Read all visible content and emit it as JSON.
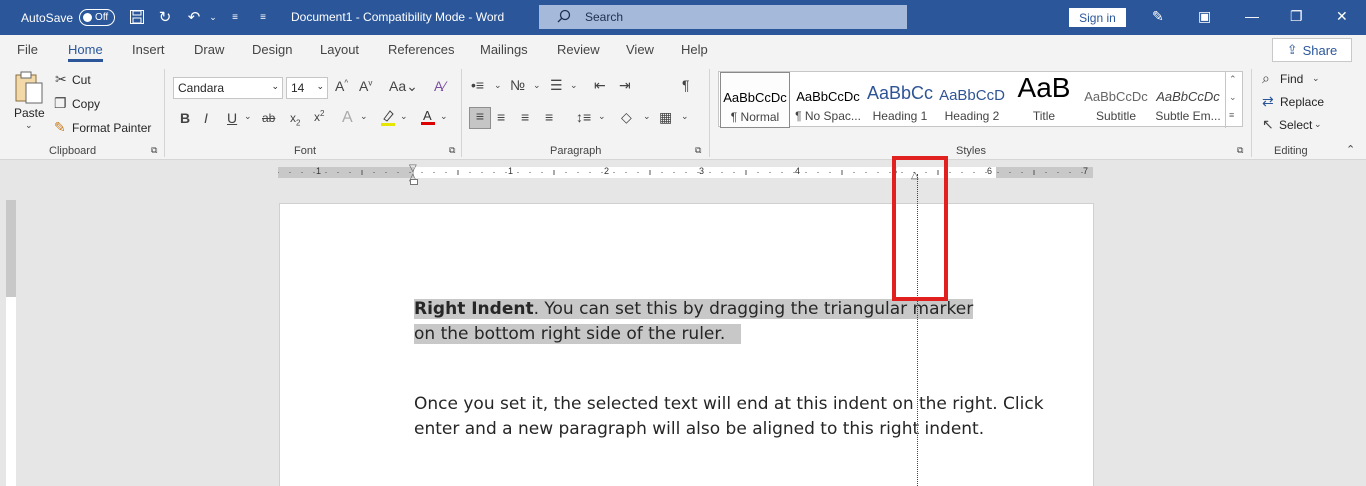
{
  "titlebar": {
    "autosave_label": "AutoSave",
    "autosave_state": "Off",
    "doc_title": "Document1  -  Compatibility Mode  -  Word",
    "search_label": "Search",
    "signin_label": "Sign in"
  },
  "tabs": {
    "items": [
      "File",
      "Home",
      "Insert",
      "Draw",
      "Design",
      "Layout",
      "References",
      "Mailings",
      "Review",
      "View",
      "Help"
    ],
    "active": "Home",
    "share_label": "Share"
  },
  "ribbon": {
    "clipboard": {
      "paste_label": "Paste",
      "cut_label": "Cut",
      "copy_label": "Copy",
      "format_painter_label": "Format Painter",
      "group_label": "Clipboard"
    },
    "font": {
      "font_name": "Candara",
      "font_size": "14",
      "group_label": "Font"
    },
    "paragraph": {
      "group_label": "Paragraph"
    },
    "styles": {
      "group_label": "Styles",
      "items": [
        {
          "sample": "AaBbCcDc",
          "name": "¶ Normal"
        },
        {
          "sample": "AaBbCcDc",
          "name": "¶ No Spac..."
        },
        {
          "sample": "AaBbCc",
          "name": "Heading 1"
        },
        {
          "sample": "AaBbCcD",
          "name": "Heading 2"
        },
        {
          "sample": "AaB",
          "name": "Title"
        },
        {
          "sample": "AaBbCcDc",
          "name": "Subtitle"
        },
        {
          "sample": "AaBbCcDc",
          "name": "Subtle Em..."
        }
      ]
    },
    "editing": {
      "find_label": "Find",
      "replace_label": "Replace",
      "select_label": "Select",
      "group_label": "Editing"
    }
  },
  "ruler": {
    "numbers": [
      "1",
      "1",
      "2",
      "3",
      "4",
      "5",
      "6",
      "7"
    ]
  },
  "document": {
    "para1_bold": "Right Indent",
    "para1_line1": ". You can set this by dragging the triangular marker",
    "para1_line2": "on the bottom right side of the ruler.",
    "para2_line1": "Once you set it, the selected text will end at this indent on the right. Click",
    "para2_line2": "enter and a new paragraph will also be aligned to this right indent."
  },
  "colors": {
    "titlebar": "#2b579a",
    "accent": "#2b579a",
    "highlight_box": "#e12020"
  }
}
